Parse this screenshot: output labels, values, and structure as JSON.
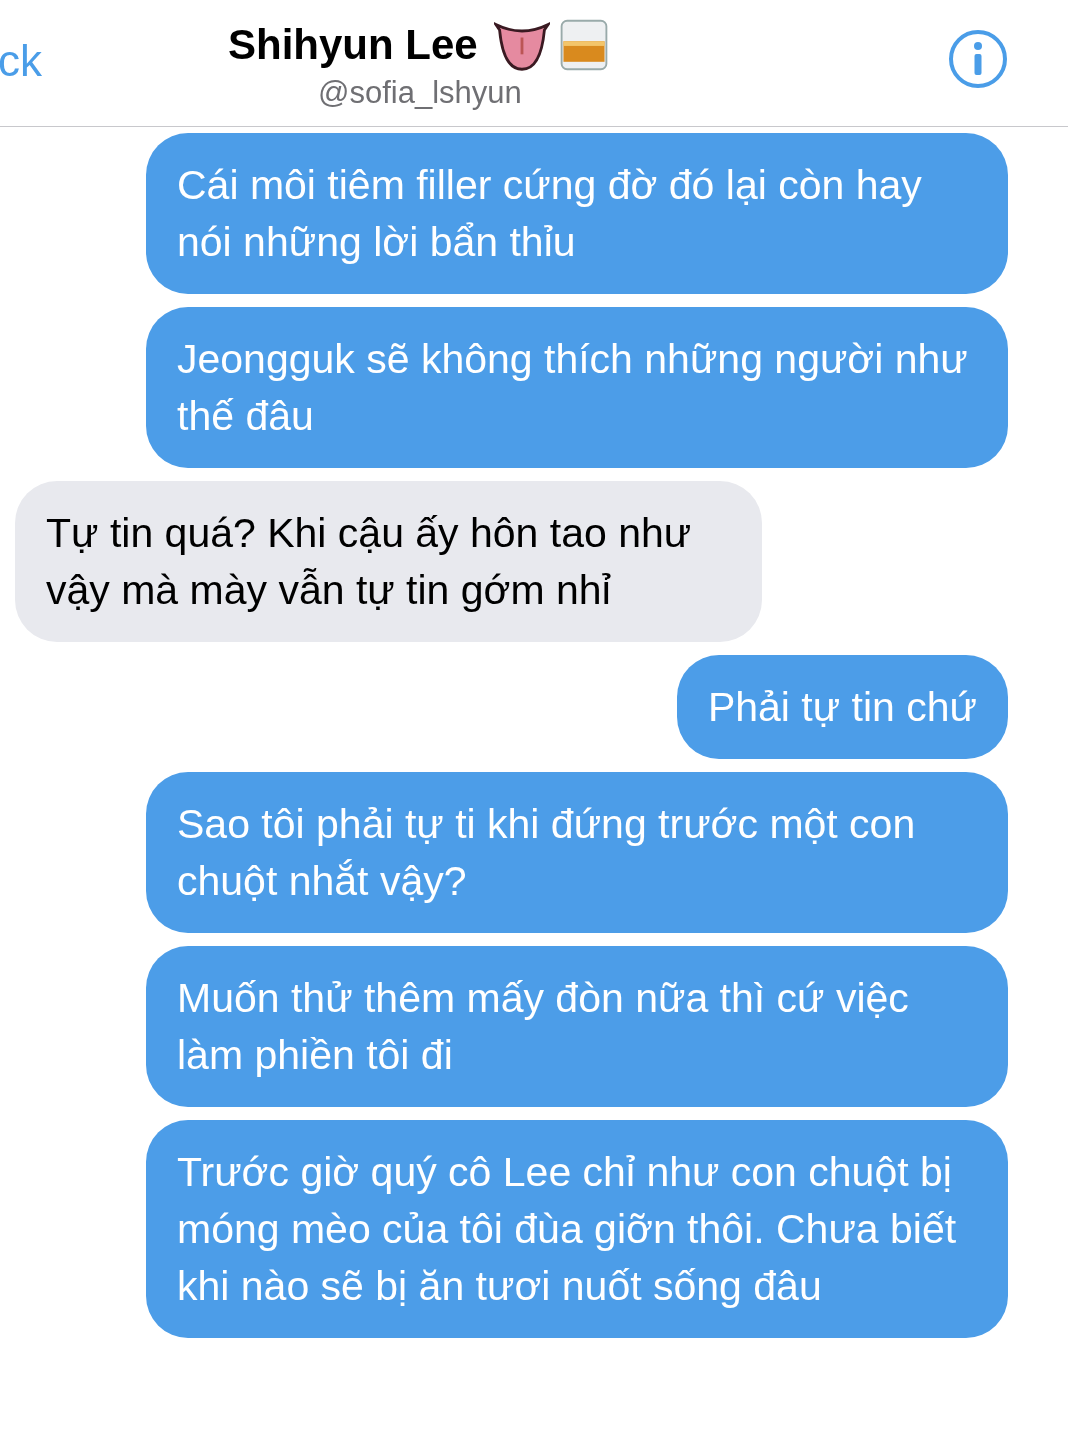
{
  "header": {
    "back": "ck",
    "title": "Shihyun Lee",
    "handle": "@sofia_lshyun"
  },
  "messages": [
    {
      "kind": "sent",
      "text": "Cái môi tiêm filler cứng đờ đó lại còn hay nói những lời bẩn thỉu"
    },
    {
      "kind": "sent",
      "text": "Jeongguk sẽ không thích những người như thế đâu"
    },
    {
      "kind": "received",
      "text": "Tự tin quá? Khi cậu ấy hôn tao như vậy mà mày vẫn tự tin gớm nhỉ"
    },
    {
      "kind": "sent",
      "text": "Phải tự tin chứ"
    },
    {
      "kind": "sent",
      "text": "Sao tôi phải tự ti khi đứng trước một con chuột nhắt vậy?"
    },
    {
      "kind": "sent",
      "text": "Muốn thử thêm mấy đòn nữa thì cứ việc làm phiền tôi đi"
    },
    {
      "kind": "sent",
      "text": "Trước giờ quý cô Lee chỉ như con chuột bị móng mèo của tôi đùa giỡn thôi. Chưa biết khi nào sẽ bị ăn tươi nuốt sống đâu"
    }
  ]
}
